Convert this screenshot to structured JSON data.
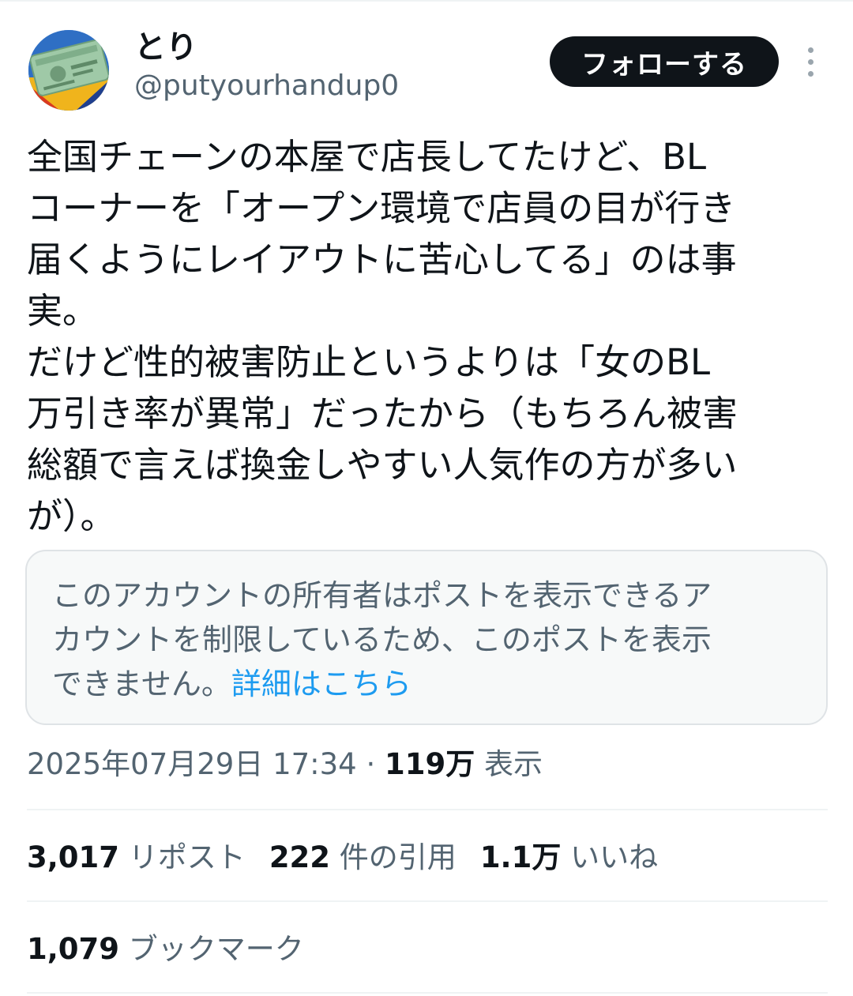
{
  "author": {
    "display_name": "とり",
    "handle": "@putyourhandup0",
    "avatar_icon": "credit-card-photo-avatar"
  },
  "header": {
    "follow_label": "フォローする",
    "more_icon": "more-vertical-icon"
  },
  "post": {
    "text": "全国チェーンの本屋で店長してたけど、BL\nコーナーを「オープン環境で店員の目が行き\n届くようにレイアウトに苦心してる」のは事\n実。\nだけど性的被害防止というよりは「女のBL\n万引き率が異常」だったから（もちろん被害\n総額で言えば換金しやすい人気作の方が多い\nが）。"
  },
  "notice": {
    "text": "このアカウントの所有者はポストを表示できるア\nカウントを制限しているため、このポストを表示\nできません。",
    "link_label": "詳細はこちら"
  },
  "meta": {
    "timestamp": "2025年07月29日 17:34",
    "separator": " · ",
    "views_count": "119万",
    "views_label": " 表示"
  },
  "stats": {
    "reposts_count": "3,017",
    "reposts_label": " リポスト",
    "quotes_count": "222",
    "quotes_label": " 件の引用",
    "likes_count": "1.1万",
    "likes_label": " いいね",
    "bookmarks_count": "1,079",
    "bookmarks_label": " ブックマーク"
  },
  "colors": {
    "text_primary": "#0f1419",
    "text_secondary": "#536471",
    "link": "#1d9bf0",
    "button_bg": "#0f1419",
    "notice_bg": "#f7f9f9",
    "divider": "#eff3f4"
  }
}
